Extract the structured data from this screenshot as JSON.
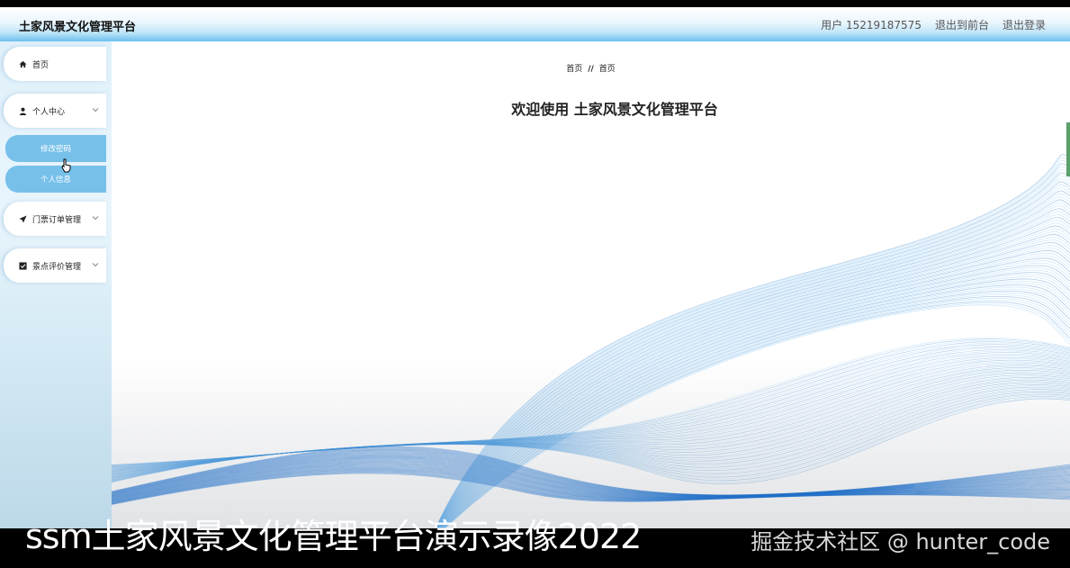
{
  "header": {
    "app_title": "土家风景文化管理平台",
    "user_label": "用户 15219187575",
    "back_to_front": "退出到前台",
    "logout": "退出登录"
  },
  "sidebar": {
    "home": "首页",
    "personal_center": "个人中心",
    "change_password": "修改密码",
    "personal_info": "个人信息",
    "ticket_orders": "门票订单管理",
    "scenic_reviews": "景点评价管理"
  },
  "main": {
    "breadcrumb_home": "首页",
    "breadcrumb_sep": "//",
    "breadcrumb_current": "首页",
    "welcome_text": "欢迎使用 土家风景文化管理平台"
  },
  "overlay": {
    "caption": "ssm土家风景文化管理平台演示录像2022",
    "watermark": "掘金技术社区 @ hunter_code"
  },
  "colors": {
    "accent": "#77c0ea",
    "wave_dark": "#1f6fc7",
    "wave_light": "#7fc3f0"
  },
  "icons": {
    "home": "home-icon",
    "user": "user-icon",
    "send": "send-icon",
    "check": "checkbox-icon",
    "chevron": "chevron-down-icon"
  }
}
